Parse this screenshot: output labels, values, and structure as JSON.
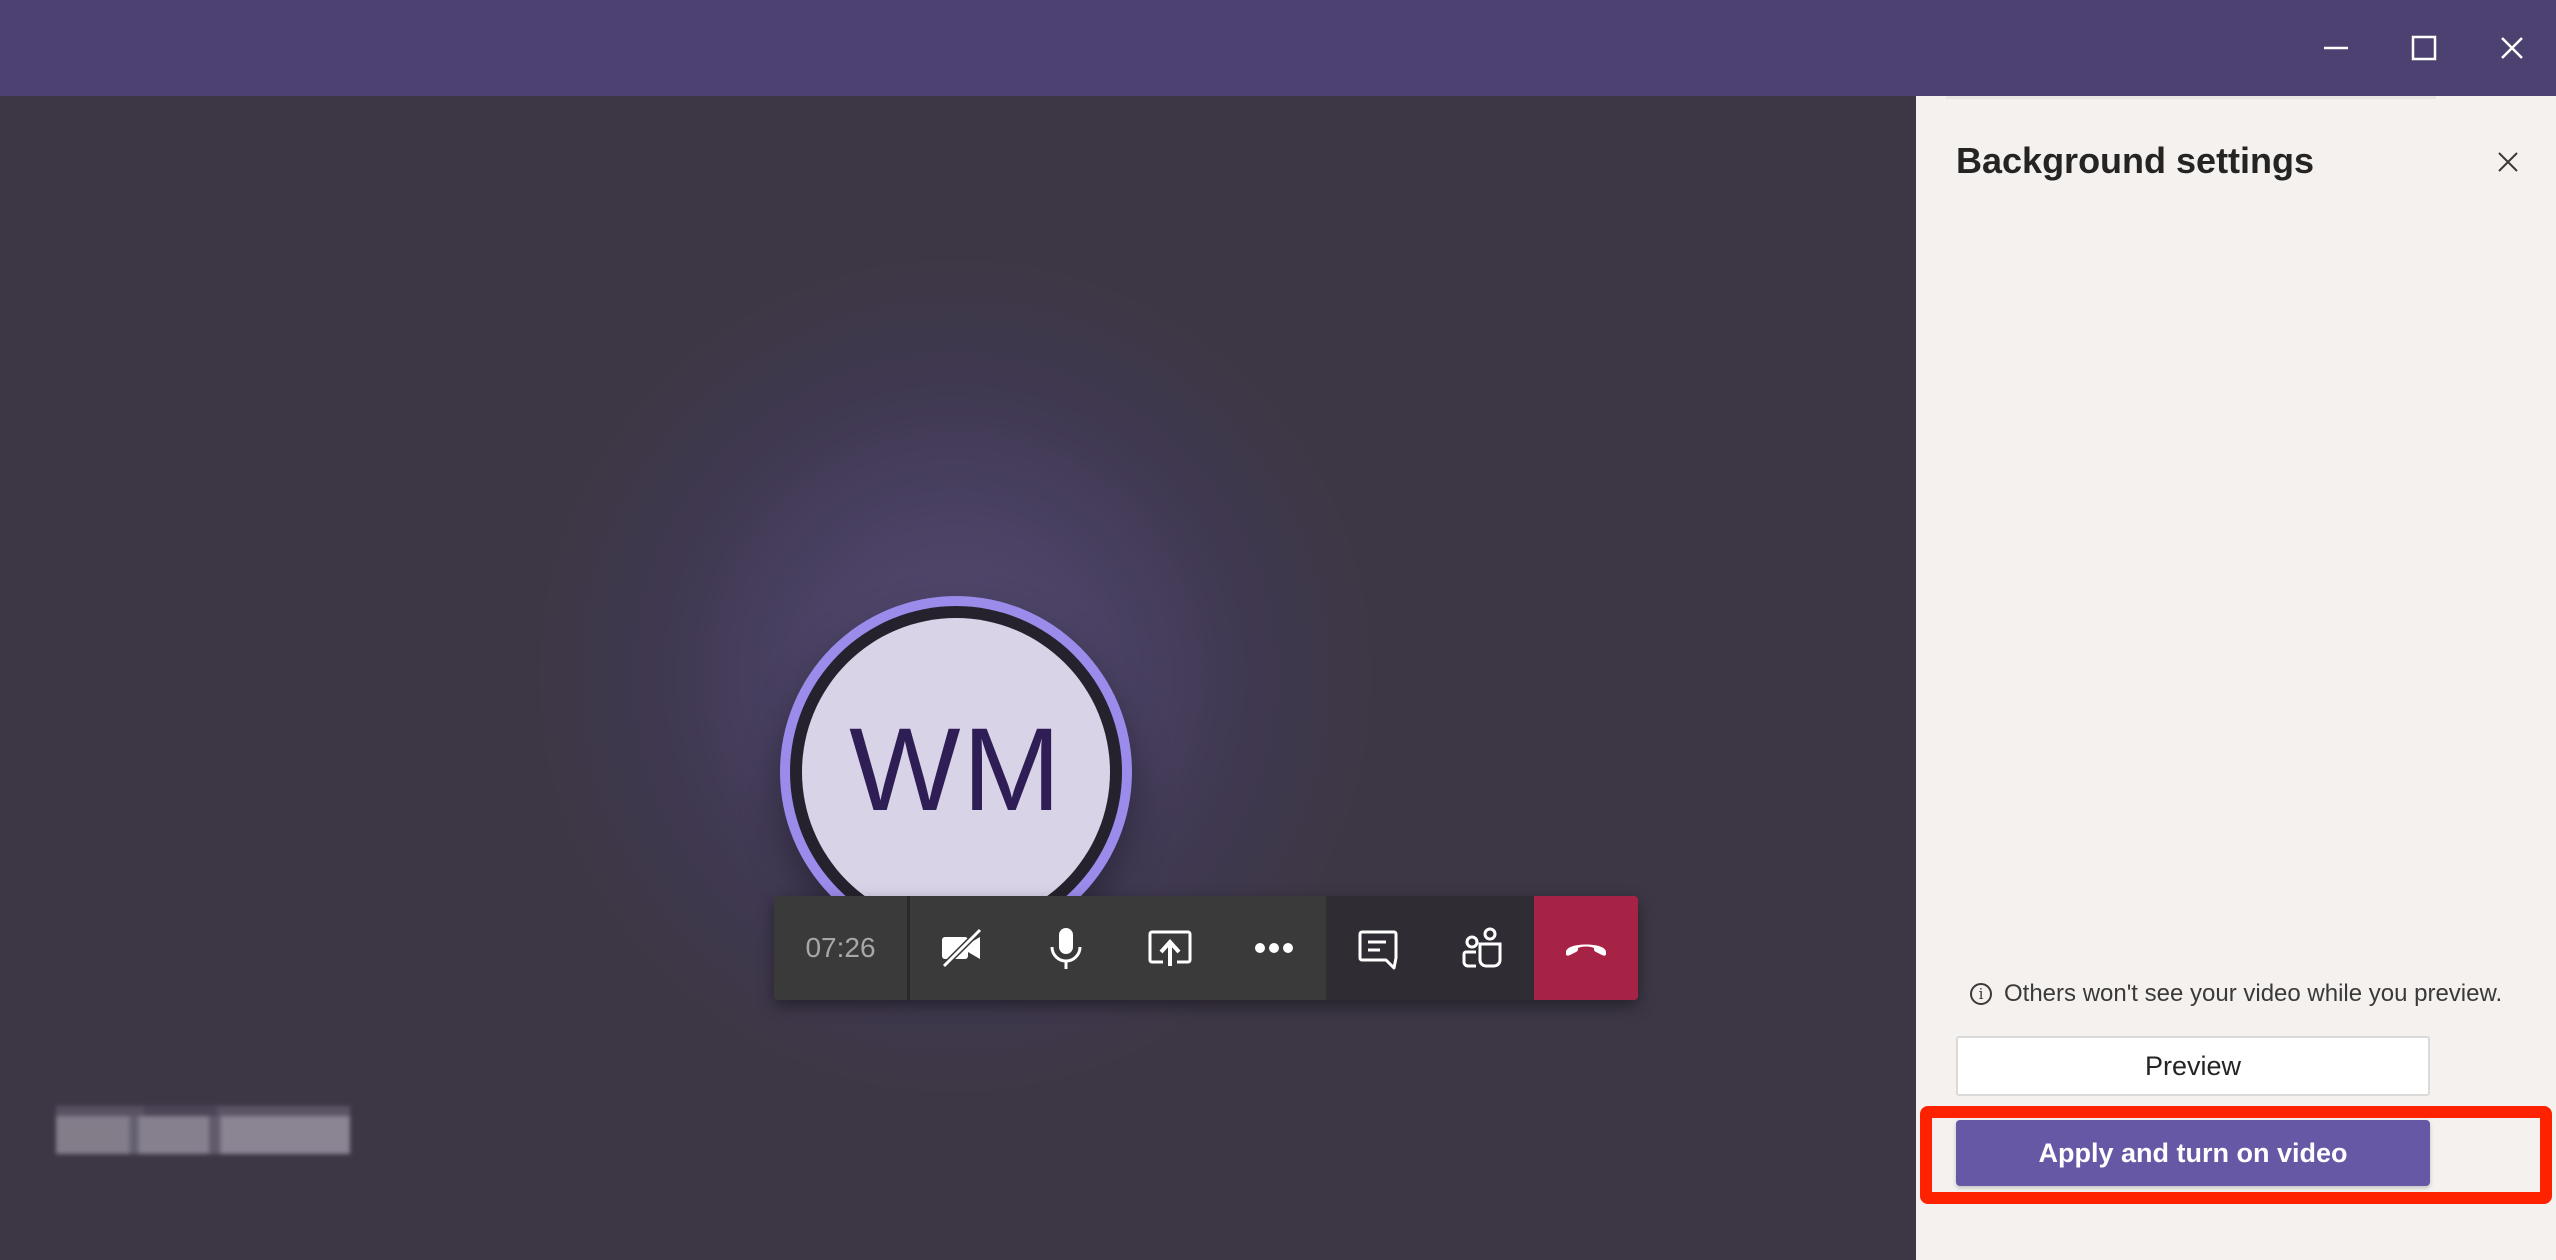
{
  "window": {
    "title_bar_color": "#4c4170",
    "controls": {
      "minimize": "minimize-icon",
      "maximize": "maximize-icon",
      "close": "close-icon"
    }
  },
  "call": {
    "avatar_initials": "WM",
    "participant_name": "[redacted]",
    "timer": "07:26",
    "toolbar": [
      {
        "id": "video",
        "icon": "video-off-icon",
        "label": "Turn camera on"
      },
      {
        "id": "mic",
        "icon": "microphone-icon",
        "label": "Mute"
      },
      {
        "id": "share",
        "icon": "share-screen-icon",
        "label": "Share"
      },
      {
        "id": "more",
        "icon": "more-options-icon",
        "label": "More actions"
      },
      {
        "id": "chat",
        "icon": "chat-icon",
        "label": "Show conversation"
      },
      {
        "id": "participants",
        "icon": "participants-icon",
        "label": "Show participants"
      },
      {
        "id": "hangup",
        "icon": "hang-up-icon",
        "label": "Hang up"
      }
    ],
    "colors": {
      "hangup": "#a72346",
      "avatar_ring": "#9b8bea",
      "avatar_bg": "#d9d3e8",
      "avatar_text": "#2f1e55"
    }
  },
  "panel": {
    "title": "Background settings",
    "close_icon": "close-icon",
    "note_icon": "info-icon",
    "note": "Others won't see your video while you preview.",
    "preview_button": "Preview",
    "apply_button": "Apply and turn on video",
    "colors": {
      "apply_button": "#6658a5",
      "highlight": "#ff2200"
    }
  }
}
